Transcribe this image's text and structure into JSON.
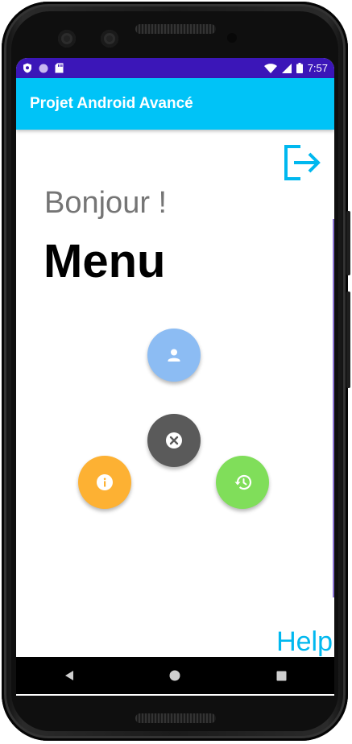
{
  "status_bar": {
    "time": "7:57",
    "icons": [
      "shield-icon",
      "circle-notification-icon",
      "sd-card-icon",
      "wifi-icon",
      "signal-icon",
      "battery-icon"
    ]
  },
  "app_bar": {
    "title": "Projet Android Avancé"
  },
  "main": {
    "greeting": "Bonjour !",
    "title": "Menu",
    "help_label": "Help"
  },
  "fab_menu": [
    {
      "name": "profile",
      "icon": "person-icon",
      "color": "#8cbcf3"
    },
    {
      "name": "close",
      "icon": "close-icon",
      "color": "#5a5a5a"
    },
    {
      "name": "info",
      "icon": "info-icon",
      "color": "#fdb133"
    },
    {
      "name": "history",
      "icon": "history-icon",
      "color": "#80de5a"
    }
  ],
  "colors": {
    "status_bar": "#3b16b8",
    "app_bar": "#00c3f7",
    "accent": "#00b8ef"
  },
  "nav_bar": {
    "buttons": [
      "back-icon",
      "home-icon",
      "recents-icon"
    ]
  }
}
